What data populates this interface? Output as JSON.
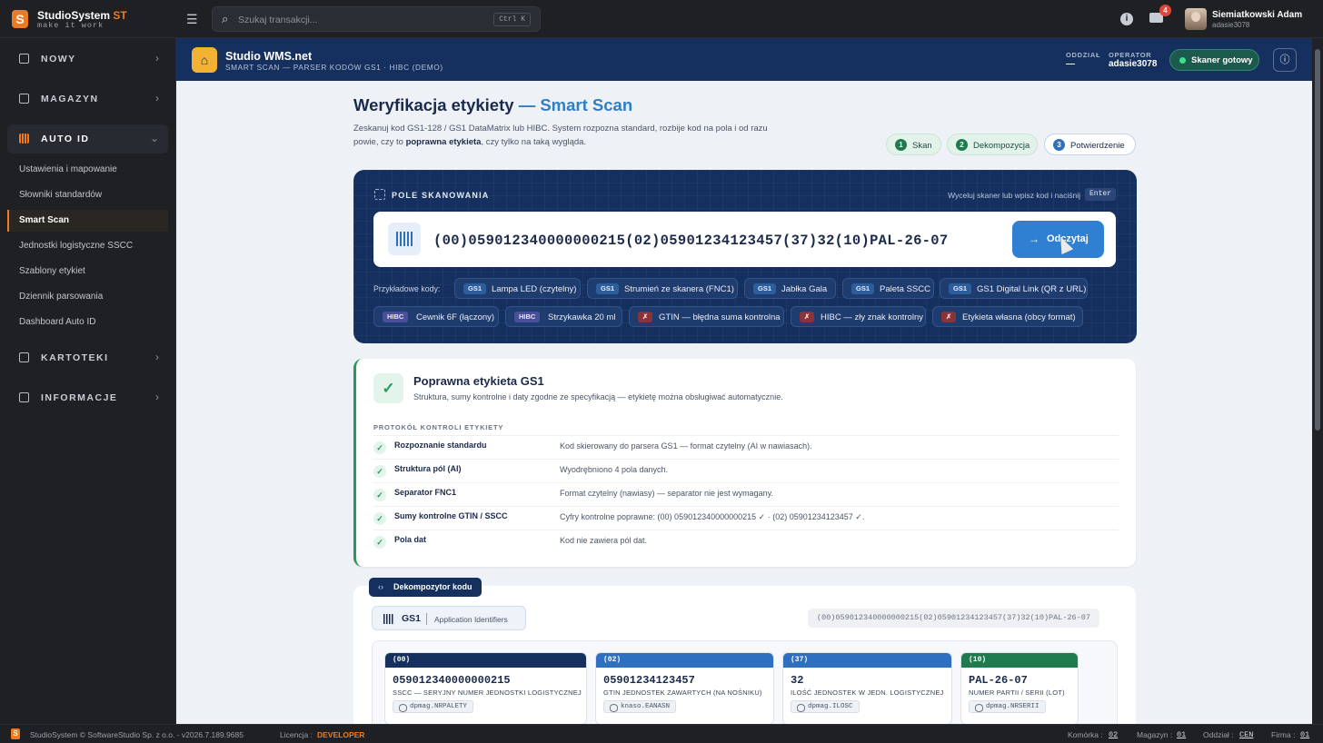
{
  "topbar": {
    "logo_letter": "S",
    "brand": "StudioSystem",
    "brand_suffix": "ST",
    "tagline": "make it work",
    "search_placeholder": "Szukaj transakcji...",
    "search_shortcut": "Ctrl K",
    "mail_count": "4",
    "user_name": "Siemiatkowski Adam",
    "user_login": "adasie3078"
  },
  "sidebar": {
    "groups": [
      {
        "label": "NOWY"
      },
      {
        "label": "MAGAZYN"
      },
      {
        "label": "AUTO ID"
      },
      {
        "label": "KARTOTEKI"
      },
      {
        "label": "INFORMACJE"
      }
    ],
    "items": [
      {
        "label": "Ustawienia i mapowanie"
      },
      {
        "label": "Słowniki standardów"
      },
      {
        "label": "Smart Scan"
      },
      {
        "label": "Jednostki logistyczne SSCC"
      },
      {
        "label": "Szablony etykiet"
      },
      {
        "label": "Dziennik parsowania"
      },
      {
        "label": "Dashboard Auto ID"
      }
    ]
  },
  "band": {
    "title": "Studio WMS.net",
    "subtitle": "SMART SCAN — PARSER KODÓW GS1 · HIBC (DEMO)",
    "branch_label": "ODDZIAŁ",
    "branch_value": "—",
    "operator_label": "OPERATOR",
    "operator_value": "adasie3078",
    "scanner_status": "Skaner gotowy"
  },
  "page": {
    "title": "Weryfikacja etykiety",
    "title_accent": "— Smart Scan",
    "desc_1": "Zeskanuj kod GS1-128 / GS1 DataMatrix lub HIBC. System rozpozna standard, rozbije kod na pola i od razu powie, czy to ",
    "desc_bold": "poprawna etykieta",
    "desc_2": ", czy tylko na taką wygląda.",
    "steps": [
      {
        "n": "1",
        "label": "Skan"
      },
      {
        "n": "2",
        "label": "Dekompozycja"
      },
      {
        "n": "3",
        "label": "Potwierdzenie"
      }
    ]
  },
  "scan": {
    "heading": "POLE SKANOWANIA",
    "hint": "Wyceluj skaner lub wpisz kod i naciśnij",
    "enter_key": "Enter",
    "code": "(00)059012340000000215(02)05901234123457(37)32(10)PAL-26-07",
    "read_button": "Odczytaj",
    "examples_label": "Przykładowe kody:",
    "examples": [
      {
        "tag": "GS1",
        "label": "Lampa LED (czytelny)"
      },
      {
        "tag": "GS1",
        "label": "Strumień ze skanera (FNC1)"
      },
      {
        "tag": "GS1",
        "label": "Jabłka Gala"
      },
      {
        "tag": "GS1",
        "label": "Paleta SSCC"
      },
      {
        "tag": "GS1",
        "label": "GS1 Digital Link (QR z URL)"
      },
      {
        "tag": "HIBC",
        "label": "Cewnik 6F (łączony)"
      },
      {
        "tag": "HIBC",
        "label": "Strzykawka 20 ml"
      },
      {
        "tag": "✗",
        "label": "GTIN — błędna suma kontrolna"
      },
      {
        "tag": "✗",
        "label": "HIBC — zły znak kontrolny"
      },
      {
        "tag": "✗",
        "label": "Etykieta własna (obcy format)"
      }
    ]
  },
  "result": {
    "title": "Poprawna etykieta GS1",
    "subtitle": "Struktura, sumy kontrolne i daty zgodne ze specyfikacją — etykietę można obsługiwać automatycznie.",
    "protocol_label": "PROTOKÓŁ KONTROLI ETYKIETY",
    "rows": [
      {
        "k": "Rozpoznanie standardu",
        "v": "Kod skierowany do parsera GS1 — format czytelny (AI w nawiasach)."
      },
      {
        "k": "Struktura pól (AI)",
        "v": "Wyodrębniono 4 pola danych."
      },
      {
        "k": "Separator FNC1",
        "v": "Format czytelny (nawiasy) — separator nie jest wymagany."
      },
      {
        "k": "Sumy kontrolne GTIN / SSCC",
        "v": "Cyfry kontrolne poprawne: (00) 059012340000000215 ✓ · (02) 05901234123457 ✓."
      },
      {
        "k": "Pola dat",
        "v": "Kod nie zawiera pól dat."
      }
    ]
  },
  "decomposer": {
    "pill": "Dekompozytor kodu",
    "standard": "GS1",
    "standard_desc": "Application Identifiers",
    "raw": "(00)059012340000000215(02)05901234123457(37)32(10)PAL-26-07",
    "fields": [
      {
        "ai": "(00)",
        "value": "059012340000000215",
        "desc": "SSCC — SERYJNY NUMER JEDNOSTKI LOGISTYCZNEJ",
        "map": "dpmag.NRPALETY",
        "color": "#15305e"
      },
      {
        "ai": "(02)",
        "value": "05901234123457",
        "desc": "GTIN JEDNOSTEK ZAWARTYCH (NA NOŚNIKU)",
        "map": "knaso.EANASN",
        "color": "#2f6fc0"
      },
      {
        "ai": "(37)",
        "value": "32",
        "desc": "ILOŚĆ JEDNOSTEK W JEDN. LOGISTYCZNEJ",
        "map": "dpmag.ILOSC",
        "color": "#2f6fc0"
      },
      {
        "ai": "(10)",
        "value": "PAL-26-07",
        "desc": "NUMER PARTII / SERII (LOT)",
        "map": "dpmag.NRSERII",
        "color": "#1f7a4e"
      }
    ]
  },
  "footer": {
    "copyright": "StudioSystem © SoftwareStudio Sp. z o.o. - v2026.7.189.9685",
    "license_label": "Licencja :",
    "license_value": "DEVELOPER",
    "cell_label": "Komórka :",
    "cell_value": "02",
    "warehouse_label": "Magazyn :",
    "warehouse_value": "01",
    "branch_label": "Oddział :",
    "branch_value": "CEN",
    "company_label": "Firma :",
    "company_value": "01"
  }
}
